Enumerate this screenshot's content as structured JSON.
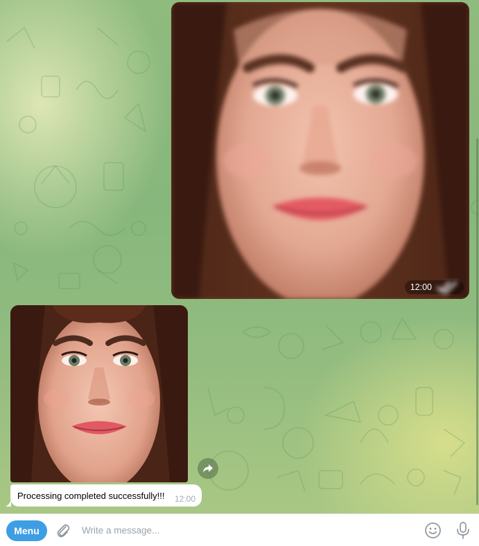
{
  "messages": [
    {
      "kind": "photo",
      "time": "12:00",
      "read_status": "double-check-icon"
    },
    {
      "kind": "photo",
      "forward_icon": "forward-arrow-icon"
    },
    {
      "kind": "text",
      "text": "Processing completed successfully!!!",
      "time": "12:00"
    }
  ],
  "composer": {
    "menu_label": "Menu",
    "placeholder": "Write a message...",
    "attach_icon": "paperclip-icon",
    "emoji_icon": "smiley-icon",
    "mic_icon": "microphone-icon"
  },
  "colors": {
    "accent": "#3e9ee3",
    "chat_background": "#8fbb7e",
    "bubble": "#ffffff",
    "time_gray": "#a0acb6"
  }
}
